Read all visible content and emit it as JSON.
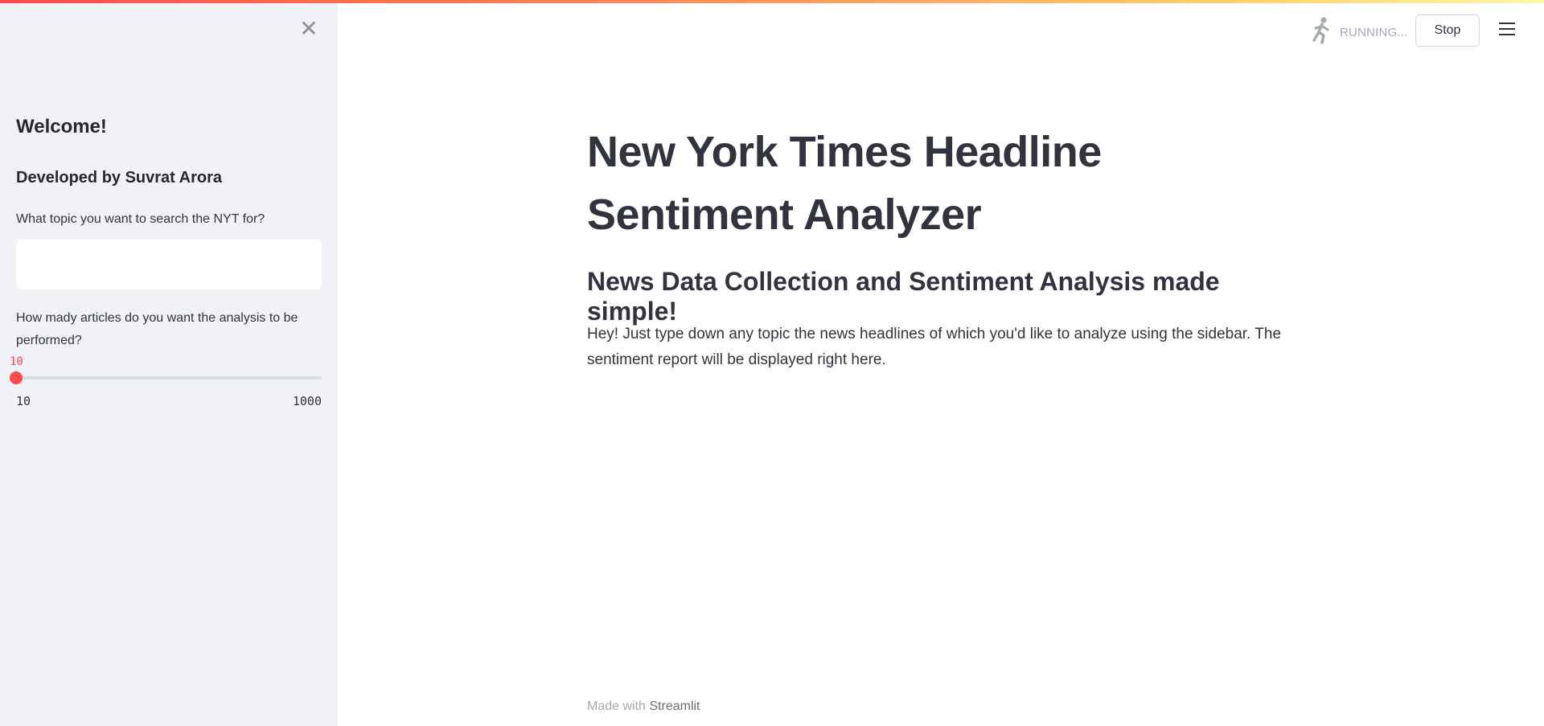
{
  "sidebar": {
    "close_icon": "close-icon",
    "welcome": "Welcome!",
    "developer": "Developed by Suvrat Arora",
    "topic_label": "What topic you want to search the NYT for?",
    "topic_value": "",
    "articles_label": "How mady articles do you want the analysis to be performed?",
    "slider": {
      "value": "10",
      "min": "10",
      "max": "1000",
      "fill_fraction": 0
    }
  },
  "header": {
    "status_icon": "running-person-icon",
    "status_text": "RUNNING...",
    "stop_label": "Stop",
    "menu_icon": "hamburger-menu-icon"
  },
  "main": {
    "title": "New York Times Headline Sentiment Analyzer",
    "subtitle": "News Data Collection and Sentiment Analysis made simple!",
    "body": "Hey! Just type down any topic the news headlines of which you'd like to analyze using the sidebar. The sentiment report will be displayed right here."
  },
  "footer": {
    "made_with": "Made with",
    "link": "Streamlit"
  },
  "colors": {
    "accent": "#ff4b4b",
    "sidebar_bg": "#f0f2f6",
    "text": "#31333f",
    "muted": "#a3a8b4"
  }
}
